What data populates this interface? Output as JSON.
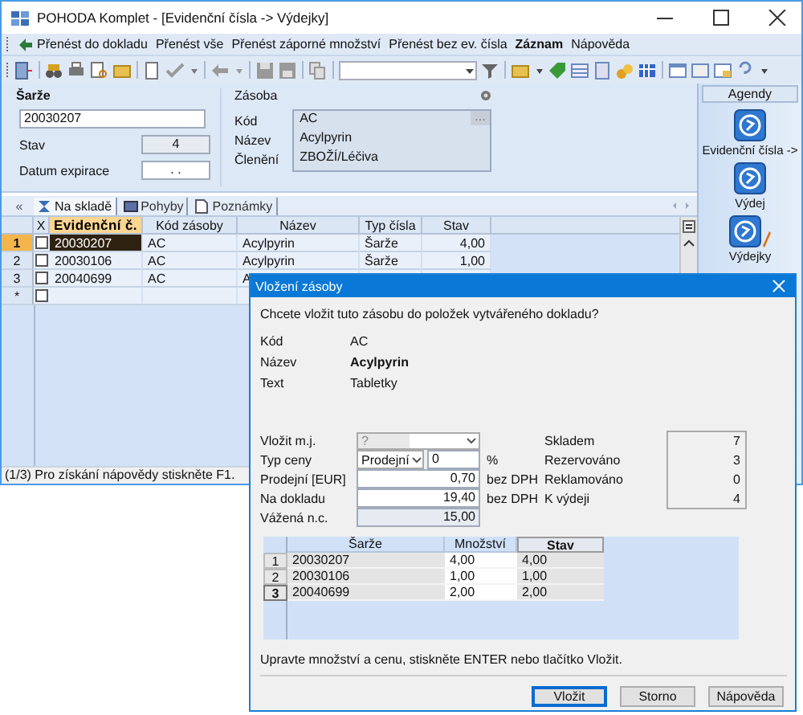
{
  "window": {
    "title": "POHODA Komplet - [Evidenční čísla -> Výdejky]"
  },
  "menu": [
    {
      "label": "Přenést do dokladu",
      "kind": "icon",
      "emphasized": false
    },
    {
      "label": "Přenést vše",
      "kind": "plain",
      "emphasized": false
    },
    {
      "label": "Přenést záporné množství",
      "kind": "plain",
      "emphasized": false
    },
    {
      "label": "Přenést bez ev. čísla",
      "kind": "plain",
      "emphasized": false
    },
    {
      "label": "Záznam",
      "kind": "plain",
      "emphasized": true
    },
    {
      "label": "Nápověda",
      "kind": "plain",
      "emphasized": false
    }
  ],
  "batch_panel": {
    "heading": "Šarže",
    "value": "20030207",
    "fields": [
      {
        "label": "Stav",
        "value": "4"
      },
      {
        "label": "Datum expirace",
        "value": ". ."
      }
    ]
  },
  "stock_panel": {
    "heading": "Zásoba",
    "button": "...",
    "rows": [
      {
        "label": "Kód",
        "value": "AC"
      },
      {
        "label": "Název",
        "value": "Acylpyrin"
      },
      {
        "label": "Členění",
        "value": "ZBOŽÍ/Léčiva"
      }
    ]
  },
  "agendas": {
    "heading": "Agendy",
    "items": [
      {
        "label": "Evidenční čísla ->",
        "edited": false
      },
      {
        "label": "Výdej",
        "edited": false
      },
      {
        "label": "Výdejky",
        "edited": true
      }
    ]
  },
  "tabs_toggle": "«",
  "tabs": [
    {
      "label": "Na skladě",
      "kind": "stock",
      "selected": true
    },
    {
      "label": "Pohyby",
      "kind": "moves",
      "selected": false
    },
    {
      "label": "Poznámky",
      "kind": "notes",
      "selected": false
    }
  ],
  "table": {
    "check_column": "X",
    "columns": [
      {
        "label": "Evidenční č.",
        "sorted": true
      },
      {
        "label": "Kód zásoby",
        "sorted": false
      },
      {
        "label": "Název",
        "sorted": false
      },
      {
        "label": "Typ čísla",
        "sorted": false
      },
      {
        "label": "Stav",
        "sorted": false
      }
    ],
    "rows": [
      {
        "marker": "1",
        "checked": false,
        "selected": true,
        "cells": [
          "20030207",
          "AC",
          "Acylpyrin",
          "Šarže",
          "4,00"
        ]
      },
      {
        "marker": "2",
        "checked": false,
        "selected": false,
        "cells": [
          "20030106",
          "AC",
          "Acylpyrin",
          "Šarže",
          "1,00"
        ]
      },
      {
        "marker": "3",
        "checked": false,
        "selected": false,
        "cells": [
          "20040699",
          "AC",
          "A"
        ]
      },
      {
        "marker": "*",
        "checked": false,
        "selected": false,
        "cells": []
      }
    ]
  },
  "status_bar": "(1/3) Pro získání nápovědy stiskněte F1.",
  "dialog": {
    "title": "Vložení zásoby",
    "question": "Chcete vložit tuto zásobu do položek vytvářeného dokladu?",
    "details": [
      {
        "label": "Kód",
        "value": "AC",
        "kind": "plain"
      },
      {
        "label": "Název",
        "value": "Acylpyrin",
        "kind": "bold"
      },
      {
        "label": "Text",
        "value": "Tabletky",
        "kind": "plain"
      }
    ],
    "unit": {
      "label": "Vložit m.j.",
      "value": "?"
    },
    "price_type": {
      "label": "Typ ceny",
      "value": "Prodejní",
      "discount": "0",
      "discount_unit": "%"
    },
    "prices": [
      {
        "label": "Prodejní [EUR]",
        "value": "0,70",
        "unit": "bez DPH",
        "editable": true
      },
      {
        "label": "Na dokladu",
        "value": "19,40",
        "unit": "bez DPH",
        "editable": true
      },
      {
        "label": "Vážená n.c.",
        "value": "15,00",
        "editable": false
      }
    ],
    "stock": [
      {
        "label": "Skladem",
        "value": "7"
      },
      {
        "label": "Rezervováno",
        "value": "3"
      },
      {
        "label": "Reklamováno",
        "value": "0"
      },
      {
        "label": "K výdeji",
        "value": "4"
      }
    ],
    "batches": {
      "columns": [
        {
          "label": "Šarže",
          "sorted": false
        },
        {
          "label": "Množství",
          "sorted": false
        },
        {
          "label": "Stav",
          "sorted": true
        }
      ],
      "rows": [
        {
          "marker": "1",
          "selected": false,
          "cells": [
            "20030207",
            "4,00",
            "4,00"
          ]
        },
        {
          "marker": "2",
          "selected": false,
          "cells": [
            "20030106",
            "1,00",
            "1,00"
          ]
        },
        {
          "marker": "3",
          "selected": true,
          "cells": [
            "20040699",
            "2,00",
            "2,00"
          ]
        }
      ]
    },
    "hint": "Upravte množství a cenu, stiskněte ENTER nebo tlačítko Vložit.",
    "buttons": [
      {
        "label": "Vložit",
        "default": true
      },
      {
        "label": "Storno",
        "default": false
      },
      {
        "label": "Nápověda",
        "default": false
      }
    ]
  }
}
